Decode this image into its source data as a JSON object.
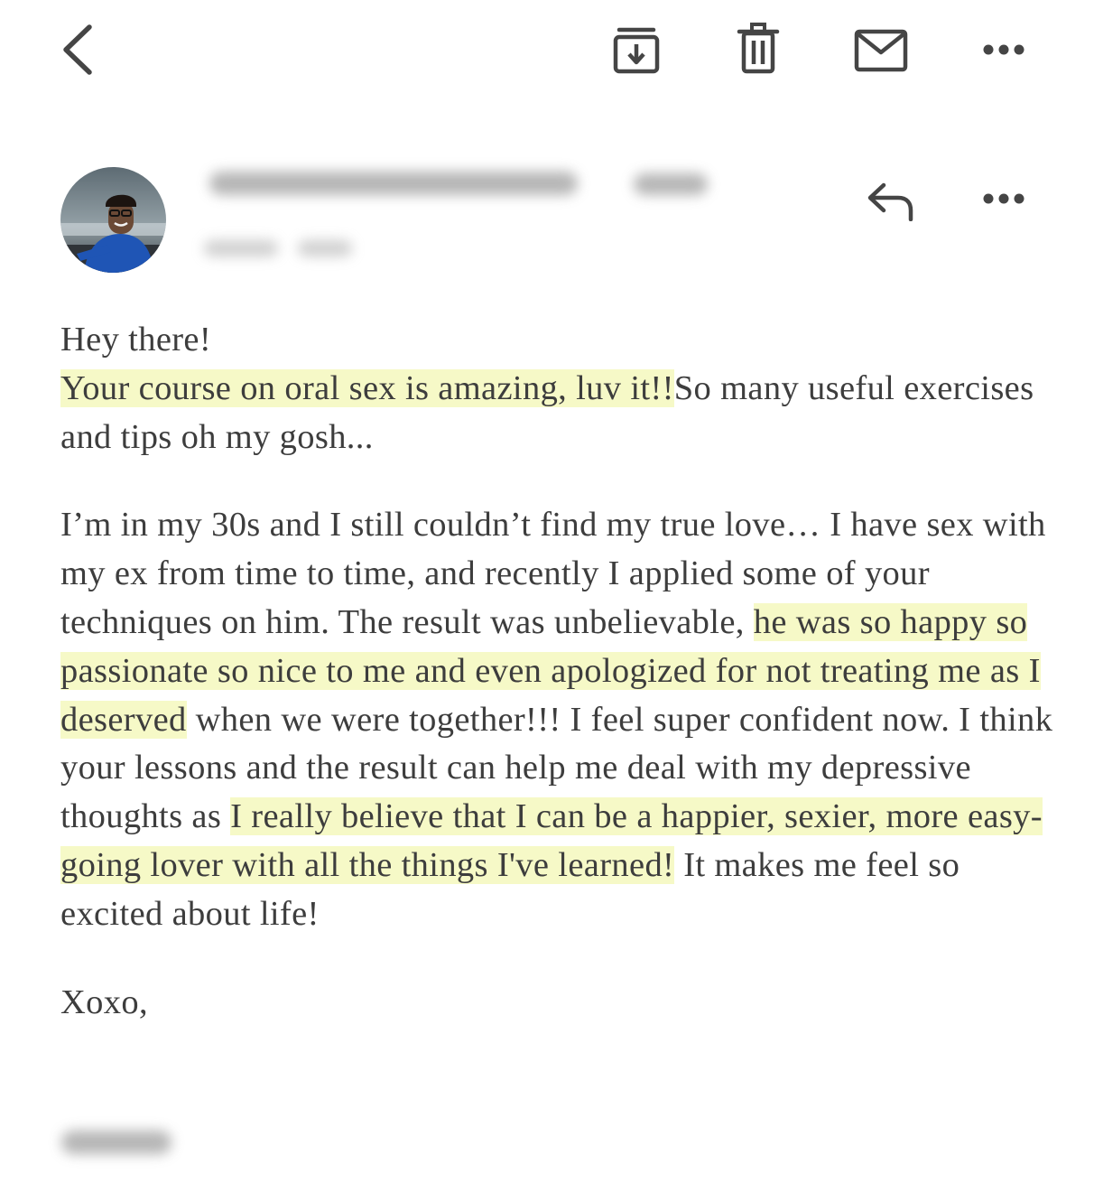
{
  "toolbar": {
    "icons": [
      "back-arrow-icon",
      "archive-icon",
      "trash-icon",
      "mail-icon",
      "more-icon"
    ]
  },
  "sender": {
    "avatar_icon": "avatar-photo",
    "actions": [
      "reply-icon",
      "more-icon"
    ]
  },
  "email": {
    "greeting": "Hey there!",
    "p1": {
      "highlight1": "Your course on oral sex is amazing, luv it!!",
      "text1": "So many useful exercises and tips oh my gosh..."
    },
    "p2": {
      "text1": "I’m in my 30s and I still couldn’t find my true love… I have sex with my ex from time to time, and recently I applied some of your techniques on him. The result was unbelievable, ",
      "highlight1": "he was so happy so passionate so nice to me and even apologized for not treating me as I deserved",
      "text2": " when we were together!!!  I feel super confident now. I think your lessons and the result can help me deal with my depressive thoughts as ",
      "highlight2": "I really believe that I can be a happier, sexier, more easy-going lover with all the things I've learned!",
      "text3": " It makes me feel so excited about life!"
    },
    "signoff": "Xoxo,"
  },
  "colors": {
    "highlight": "#f6f9c7",
    "text": "#3d3d3d",
    "icon": "#444444"
  }
}
